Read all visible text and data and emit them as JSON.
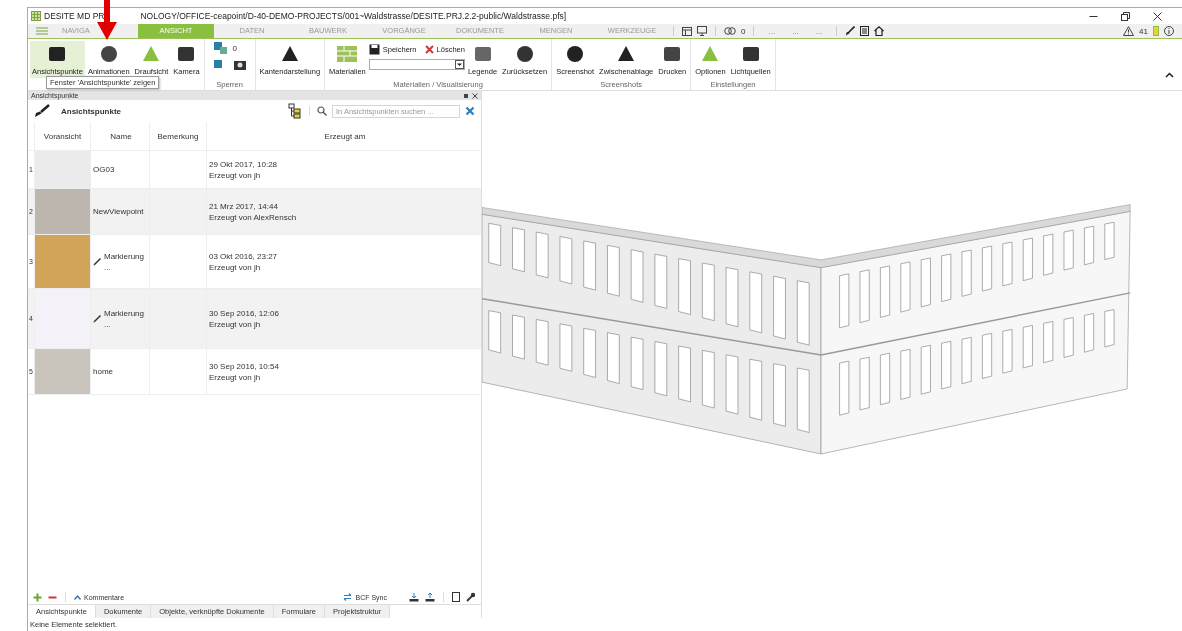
{
  "window": {
    "title_start": "DESITE MD PR",
    "title_end": "NOLOGY/OFFICE-ceapoint/D-40-DEMO-PROJECTS/001~Waldstrasse/DESITE.PRJ.2.2-public/Waldstrasse.pfs]"
  },
  "tabs": [
    {
      "label": "NAVIGA",
      "selected": false
    },
    {
      "label": "ANSICHT",
      "selected": true
    },
    {
      "label": "DATEN",
      "selected": false
    },
    {
      "label": "BAUWERK",
      "selected": false
    },
    {
      "label": "VORGÄNGE",
      "selected": false
    },
    {
      "label": "DOKUMENTE",
      "selected": false
    },
    {
      "label": "MENGEN",
      "selected": false
    },
    {
      "label": "WERKZEUGE",
      "selected": false
    }
  ],
  "quick_toolbar": {
    "eye_count": "0",
    "dots": [
      "...",
      "...",
      "..."
    ],
    "warning_count": "41"
  },
  "ribbon": {
    "groups": [
      {
        "buttons": [
          {
            "label": "Ansichtspunkte",
            "selected": true
          },
          {
            "label": "Animationen",
            "selected": false
          },
          {
            "label": "Draufsicht",
            "selected": false
          },
          {
            "label": "Kamera",
            "selected": false
          }
        ]
      },
      {
        "label": "Sperren",
        "count": "0"
      },
      {
        "buttons": [
          {
            "label": "Kantendarstellung",
            "selected": false
          }
        ]
      },
      {
        "label": "Materialien / Visualisierung",
        "materials_label": "Materialien",
        "save": "Speichern",
        "delete": "Löschen",
        "buttons": [
          {
            "label": "Legende",
            "selected": false
          },
          {
            "label": "Zurücksetzen",
            "selected": false
          }
        ]
      },
      {
        "label": "Screenshots",
        "buttons": [
          {
            "label": "Screenshot",
            "selected": false
          },
          {
            "label": "Zwischenablage",
            "selected": false
          },
          {
            "label": "Drucken",
            "selected": false
          }
        ]
      },
      {
        "label": "Einstellungen",
        "buttons": [
          {
            "label": "Optionen",
            "selected": false
          },
          {
            "label": "Lichtquellen",
            "selected": false
          }
        ]
      }
    ]
  },
  "tooltip": "Fenster 'Ansichtspunkte' zeigen",
  "panel": {
    "title": "Ansichtspunkte",
    "heading": "Ansichtspunkte",
    "search": {
      "placeholder": "In Ansichtspunkten suchen ..."
    },
    "columns": [
      "Voransicht",
      "Name",
      "Bemerkung",
      "Erzeugt am"
    ],
    "rows": [
      {
        "number": "1",
        "kind": "viewpoint",
        "name": "OG03",
        "date": "29 Okt 2017, 10:28",
        "author": "Erzeugt von jh"
      },
      {
        "number": "2",
        "kind": "viewpoint",
        "name": "NewViewpoint",
        "date": "21 Mrz 2017, 14:44",
        "author": "Erzeugt von AlexRensch"
      },
      {
        "number": "3",
        "kind": "markup",
        "name": "Markierung",
        "note": "...",
        "date": "03 Okt 2016, 23:27",
        "author": "Erzeugt von jh"
      },
      {
        "number": "4",
        "kind": "markup",
        "name": "Markierung",
        "note": "...",
        "date": "30 Sep 2016, 12:06",
        "author": "Erzeugt von jh"
      },
      {
        "number": "5",
        "kind": "viewpoint",
        "name": "home",
        "date": "30 Sep 2016, 10:54",
        "author": "Erzeugt von jh"
      }
    ],
    "footer": {
      "comments": "Kommentare",
      "bcf": "BCF Sync"
    },
    "tabs": [
      {
        "label": "Ansichtspunkte",
        "selected": true
      },
      {
        "label": "Dokumente",
        "selected": false
      },
      {
        "label": "Objekte, verknüpfte Dokumente",
        "selected": false
      },
      {
        "label": "Formulare",
        "selected": false
      },
      {
        "label": "Projektstruktur",
        "selected": false
      }
    ]
  },
  "status_bar": "Keine Elemente selektiert."
}
